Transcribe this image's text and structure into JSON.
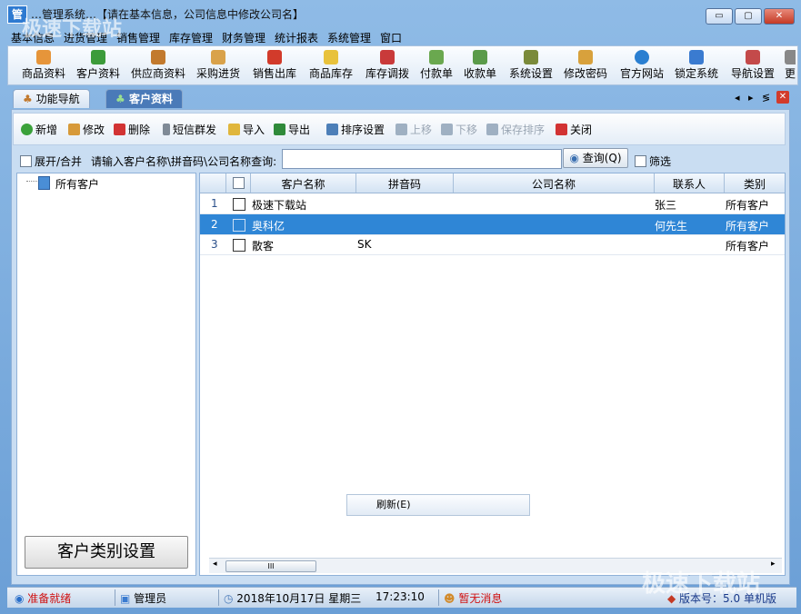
{
  "window": {
    "app_icon_text": "管",
    "title": "…管理系统…【请在基本信息，公司信息中修改公司名】",
    "minimize_label": "▭",
    "maximize_label": "▢",
    "close_label": "✕"
  },
  "menu": [
    "基本信息",
    "进货管理",
    "销售管理",
    "库存管理",
    "财务管理",
    "统计报表",
    "系统管理",
    "窗口"
  ],
  "toolbar": {
    "items": [
      {
        "label": "商品资料",
        "icon": "goods-icon",
        "color": "#e6953a"
      },
      {
        "label": "客户资料",
        "icon": "customers-icon",
        "color": "#3c9b3a"
      },
      {
        "label": "供应商资料",
        "icon": "supplier-icon",
        "color": "#c27a2e"
      },
      {
        "label": "采购进货",
        "icon": "truck-icon",
        "color": "#d9a24a"
      },
      {
        "label": "销售出库",
        "icon": "sales-icon",
        "color": "#d23b2b"
      },
      {
        "label": "商品库存",
        "icon": "inventory-icon",
        "color": "#e8c23c"
      },
      {
        "label": "库存调拨",
        "icon": "transfer-icon",
        "color": "#c93a3a"
      },
      {
        "label": "付款单",
        "icon": "payment-icon",
        "color": "#6aa84f"
      },
      {
        "label": "收款单",
        "icon": "receipt-icon",
        "color": "#5b9b4a"
      },
      {
        "label": "系统设置",
        "icon": "settings-icon",
        "color": "#7a8a3a"
      },
      {
        "label": "修改密码",
        "icon": "key-icon",
        "color": "#d8a13c"
      },
      {
        "label": "官方网站",
        "icon": "ie-icon",
        "color": "#2a7fd1"
      },
      {
        "label": "锁定系统",
        "icon": "lock-icon",
        "color": "#3a7bd0"
      },
      {
        "label": "导航设置",
        "icon": "nav-settings-icon",
        "color": "#c44a4a"
      },
      {
        "label": "更",
        "icon": "more-icon",
        "color": "#888888"
      }
    ]
  },
  "tabs": [
    {
      "label": "功能导航",
      "active": false
    },
    {
      "label": "客户资料",
      "active": true
    }
  ],
  "tab_controls": {
    "prev": "◂",
    "next": "▸",
    "list": "≶",
    "close": "✕"
  },
  "actions": [
    {
      "label": "新增",
      "icon": "add-icon",
      "color": "#3aa13a",
      "enabled": true
    },
    {
      "label": "修改",
      "icon": "edit-icon",
      "color": "#d79a3a",
      "enabled": true
    },
    {
      "label": "删除",
      "icon": "delete-icon",
      "color": "#d23333",
      "enabled": true
    },
    {
      "label": "短信群发",
      "icon": "sms-icon",
      "color": "#7f8a96",
      "enabled": true
    },
    {
      "label": "导入",
      "icon": "import-icon",
      "color": "#e0b63c",
      "enabled": true
    },
    {
      "label": "导出",
      "icon": "export-icon",
      "color": "#2f8a3a",
      "enabled": true
    },
    {
      "label": "排序设置",
      "icon": "sort-settings-icon",
      "color": "#4d7fb8",
      "enabled": true
    },
    {
      "label": "上移",
      "icon": "move-up-icon",
      "color": "#9fb0c2",
      "enabled": false
    },
    {
      "label": "下移",
      "icon": "move-down-icon",
      "color": "#9fb0c2",
      "enabled": false
    },
    {
      "label": "保存排序",
      "icon": "save-sort-icon",
      "color": "#9fb0c2",
      "enabled": false
    },
    {
      "label": "关闭",
      "icon": "close-icon",
      "color": "#d23333",
      "enabled": true
    }
  ],
  "search": {
    "expand_label": "展开/合并",
    "prompt": "请输入客户名称\\拼音码\\公司名称查询:",
    "value": "",
    "query_button": "查询(Q)",
    "filter_label": "筛选"
  },
  "tree": {
    "root": "所有客户"
  },
  "category_button": "客户类别设置",
  "grid": {
    "columns": [
      "",
      "客户名称",
      "拼音码",
      "公司名称",
      "联系人",
      "类别"
    ],
    "rows": [
      {
        "no": "1",
        "name": "极速下载站",
        "pinyin": "",
        "company": "",
        "contact": "张三",
        "category": "所有客户",
        "selected": false
      },
      {
        "no": "2",
        "name": "奥科亿",
        "pinyin": "",
        "company": "",
        "contact": "何先生",
        "category": "所有客户",
        "selected": true
      },
      {
        "no": "3",
        "name": "散客",
        "pinyin": "SK",
        "company": "",
        "contact": "",
        "category": "所有客户",
        "selected": false
      }
    ]
  },
  "context_menu": {
    "refresh": "刷新(E)"
  },
  "scroll_thumb_label": "III",
  "status": {
    "state": "准备就绪",
    "user": "管理员",
    "date": "2018年10月17日 星期三",
    "time": "17:23:10",
    "messages": "暂无消息",
    "version": "版本号：5.0 单机版"
  },
  "watermark": "极速下载站",
  "colors": {
    "selection": "#2f86d6",
    "status_alert": "#d01010"
  }
}
